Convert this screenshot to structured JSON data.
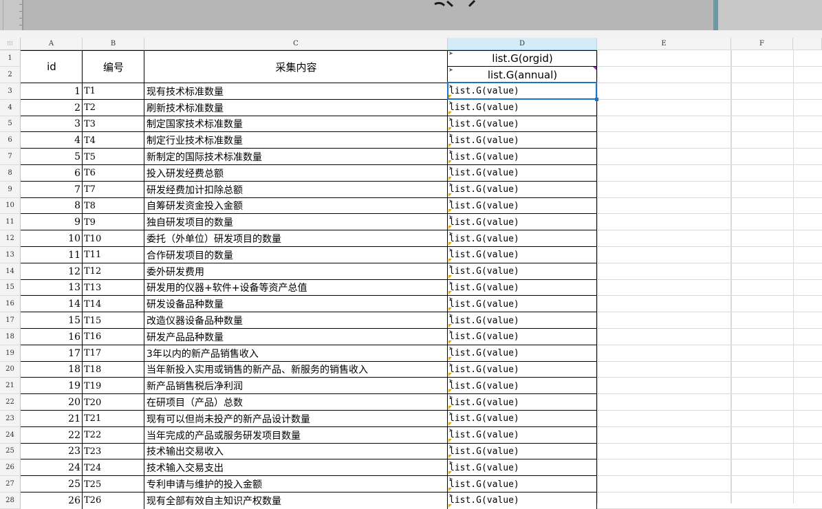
{
  "columns": [
    "A",
    "B",
    "C",
    "D",
    "E",
    "F"
  ],
  "selected_column": "D",
  "headers": {
    "id": "id",
    "code": "编号",
    "content": "采集内容",
    "d_row1": "list.G(orgid)",
    "d_row2": "list.G(annual)"
  },
  "header_row_numbers": [
    "1",
    "2"
  ],
  "rows": [
    {
      "rownum": "3",
      "id": "1",
      "code": "T1",
      "desc": "现有技术标准数量",
      "value": "list.G(value)"
    },
    {
      "rownum": "4",
      "id": "2",
      "code": "T2",
      "desc": "刷新技术标准数量",
      "value": "list.G(value)"
    },
    {
      "rownum": "5",
      "id": "3",
      "code": "T3",
      "desc": "制定国家技术标准数量",
      "value": "list.G(value)"
    },
    {
      "rownum": "6",
      "id": "4",
      "code": "T4",
      "desc": "制定行业技术标准数量",
      "value": "list.G(value)"
    },
    {
      "rownum": "7",
      "id": "5",
      "code": "T5",
      "desc": "新制定的国际技术标准数量",
      "value": "list.G(value)"
    },
    {
      "rownum": "8",
      "id": "6",
      "code": "T6",
      "desc": "投入研发经费总额",
      "value": "list.G(value)"
    },
    {
      "rownum": "9",
      "id": "7",
      "code": "T7",
      "desc": "研发经费加计扣除总额",
      "value": "list.G(value)"
    },
    {
      "rownum": "10",
      "id": "8",
      "code": "T8",
      "desc": "自筹研发资金投入金额",
      "value": "list.G(value)"
    },
    {
      "rownum": "11",
      "id": "9",
      "code": "T9",
      "desc": "独自研发项目的数量",
      "value": "list.G(value)"
    },
    {
      "rownum": "12",
      "id": "10",
      "code": "T10",
      "desc": "委托（外单位）研发项目的数量",
      "value": "list.G(value)"
    },
    {
      "rownum": "13",
      "id": "11",
      "code": "T11",
      "desc": "合作研发项目的数量",
      "value": "list.G(value)"
    },
    {
      "rownum": "14",
      "id": "12",
      "code": "T12",
      "desc": "委外研发费用",
      "value": "list.G(value)"
    },
    {
      "rownum": "15",
      "id": "13",
      "code": "T13",
      "desc": "研发用的仪器+软件+设备等资产总值",
      "value": "list.G(value)"
    },
    {
      "rownum": "16",
      "id": "14",
      "code": "T14",
      "desc": "研发设备品种数量",
      "value": "list.G(value)"
    },
    {
      "rownum": "17",
      "id": "15",
      "code": "T15",
      "desc": "改造仪器设备品种数量",
      "value": "list.G(value)"
    },
    {
      "rownum": "18",
      "id": "16",
      "code": "T16",
      "desc": "研发产品品种数量",
      "value": "list.G(value)"
    },
    {
      "rownum": "19",
      "id": "17",
      "code": "T17",
      "desc": "3年以内的新产品销售收入",
      "value": "list.G(value)"
    },
    {
      "rownum": "20",
      "id": "18",
      "code": "T18",
      "desc": "当年新投入实用或销售的新产品、新服务的销售收入",
      "value": "list.G(value)"
    },
    {
      "rownum": "21",
      "id": "19",
      "code": "T19",
      "desc": "新产品销售税后净利润",
      "value": "list.G(value)"
    },
    {
      "rownum": "22",
      "id": "20",
      "code": "T20",
      "desc": "在研项目（产品）总数",
      "value": "list.G(value)"
    },
    {
      "rownum": "23",
      "id": "21",
      "code": "T21",
      "desc": "现有可以但尚未投产的新产品设计数量",
      "value": "list.G(value)"
    },
    {
      "rownum": "24",
      "id": "22",
      "code": "T22",
      "desc": "当年完成的产品或服务研发项目数量",
      "value": "list.G(value)"
    },
    {
      "rownum": "25",
      "id": "23",
      "code": "T23",
      "desc": "技术输出交易收入",
      "value": "list.G(value)"
    },
    {
      "rownum": "26",
      "id": "24",
      "code": "T24",
      "desc": "技术输入交易支出",
      "value": "list.G(value)"
    },
    {
      "rownum": "27",
      "id": "25",
      "code": "T25",
      "desc": "专利申请与维护的投入金额",
      "value": "list.G(value)"
    },
    {
      "rownum": "28",
      "id": "26",
      "code": "T26",
      "desc": "现有全部有效自主知识产权数量",
      "value": "list.G(value)"
    }
  ],
  "colors": {
    "selection": "#1a73c9",
    "selected_header": "#d3ecf8",
    "marker": "#e6a400"
  }
}
